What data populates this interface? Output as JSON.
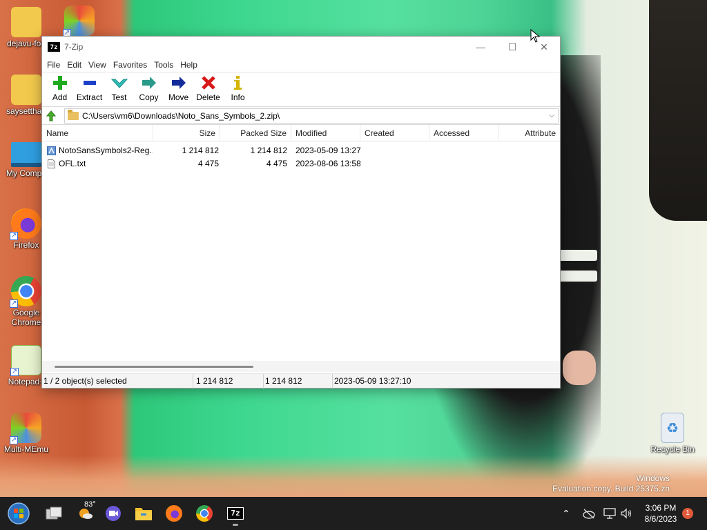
{
  "desktop": {
    "icons": [
      {
        "label": "dejavu-fon"
      },
      {
        "label": "saysettha_"
      },
      {
        "label": "My Compu"
      },
      {
        "label": "Firefox"
      },
      {
        "label": "Google Chrome"
      },
      {
        "label": "Notepad+"
      },
      {
        "label": "Multi-MEmu"
      },
      {
        "label": "Recycle Bin"
      }
    ],
    "watermark_line1": "Windows",
    "watermark_line2": "Evaluation copy. Build 25375.zn"
  },
  "window": {
    "logo_text": "7z",
    "title": "7-Zip",
    "controls": {
      "minimize": "—",
      "maximize": "☐",
      "close": "✕"
    },
    "menu": [
      "File",
      "Edit",
      "View",
      "Favorites",
      "Tools",
      "Help"
    ],
    "toolbar": [
      {
        "label": "Add",
        "icon": "plus-icon",
        "color": "#1faa1f"
      },
      {
        "label": "Extract",
        "icon": "minus-icon",
        "color": "#1a3fc8"
      },
      {
        "label": "Test",
        "icon": "check-icon",
        "color": "#2ec0b8"
      },
      {
        "label": "Copy",
        "icon": "copy-arrow-icon",
        "color": "#2a9a8a"
      },
      {
        "label": "Move",
        "icon": "move-arrow-icon",
        "color": "#142c9a"
      },
      {
        "label": "Delete",
        "icon": "x-icon",
        "color": "#d81818"
      },
      {
        "label": "Info",
        "icon": "info-icon",
        "color": "#d4b400"
      }
    ],
    "address": "C:\\Users\\vm6\\Downloads\\Noto_Sans_Symbols_2.zip\\",
    "columns": [
      "Name",
      "Size",
      "Packed Size",
      "Modified",
      "Created",
      "Accessed",
      "Attribute"
    ],
    "files": [
      {
        "name": "NotoSansSymbols2-Reg...",
        "size": "1 214 812",
        "packed": "1 214 812",
        "modified": "2023-05-09 13:27",
        "created": "",
        "accessed": "",
        "icon": "font-file-icon"
      },
      {
        "name": "OFL.txt",
        "size": "4 475",
        "packed": "4 475",
        "modified": "2023-08-06 13:58",
        "created": "",
        "accessed": "",
        "icon": "text-file-icon"
      }
    ],
    "status": {
      "selection": "1 / 2 object(s) selected",
      "size": "1 214 812",
      "packed": "1 214 812",
      "modified": "2023-05-09 13:27:10"
    }
  },
  "taskbar": {
    "weather_temp": "83°",
    "active_app": "7z",
    "time": "3:06 PM",
    "date": "8/6/2023",
    "notifications": "1"
  }
}
